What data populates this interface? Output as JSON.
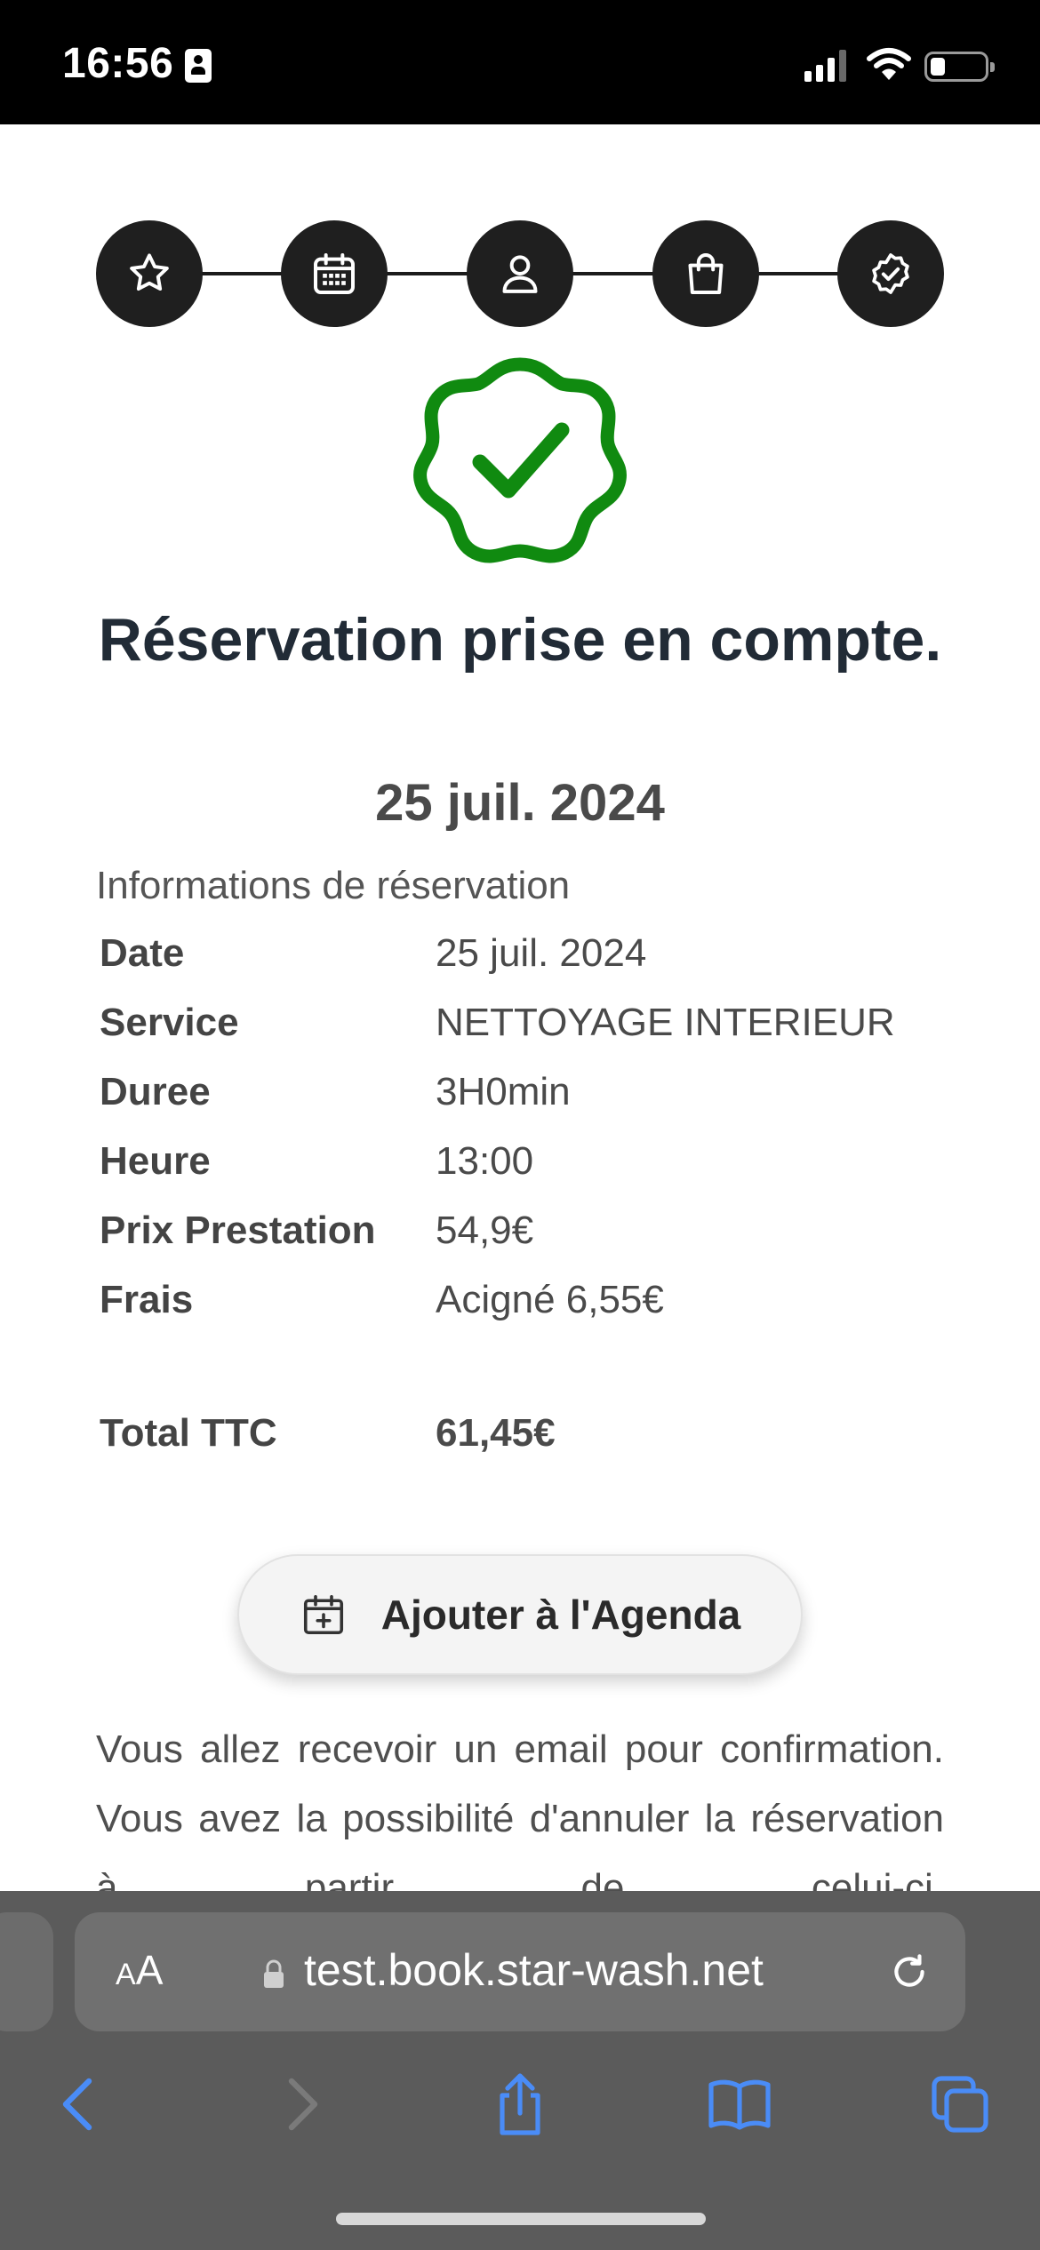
{
  "status_bar": {
    "time": "16:56"
  },
  "stepper": {
    "steps": [
      {
        "name": "star",
        "icon": "star-icon"
      },
      {
        "name": "calendar",
        "icon": "calendar-icon"
      },
      {
        "name": "user",
        "icon": "user-icon"
      },
      {
        "name": "bag",
        "icon": "shopping-bag-icon"
      },
      {
        "name": "confirm",
        "icon": "check-badge-icon"
      }
    ]
  },
  "confirmation": {
    "title": "Réservation prise en compte.",
    "date": "25 juil. 2024",
    "success_color": "#108a10"
  },
  "reservation": {
    "section_title": "Informations de réservation",
    "rows": [
      {
        "label": "Date",
        "value": "25 juil. 2024"
      },
      {
        "label": "Service",
        "value": "NETTOYAGE INTERIEUR"
      },
      {
        "label": "Duree",
        "value": "3H0min"
      },
      {
        "label": "Heure",
        "value": "13:00"
      },
      {
        "label": "Prix Prestation",
        "value": "54,9€"
      },
      {
        "label": "Frais",
        "value": "Acigné 6,55€"
      }
    ],
    "total": {
      "label": "Total TTC",
      "value": "61,45€"
    }
  },
  "agenda_button": {
    "label": "Ajouter à l'Agenda"
  },
  "message": "Vous allez recevoir un email pour confirmation. Vous avez la possibilité d'annuler la réservation à partir de celui-ci.",
  "browser": {
    "aa_label_small": "A",
    "aa_label_large": "A",
    "url": "test.book.star-wash.net",
    "accent_color": "#3b82f6"
  }
}
